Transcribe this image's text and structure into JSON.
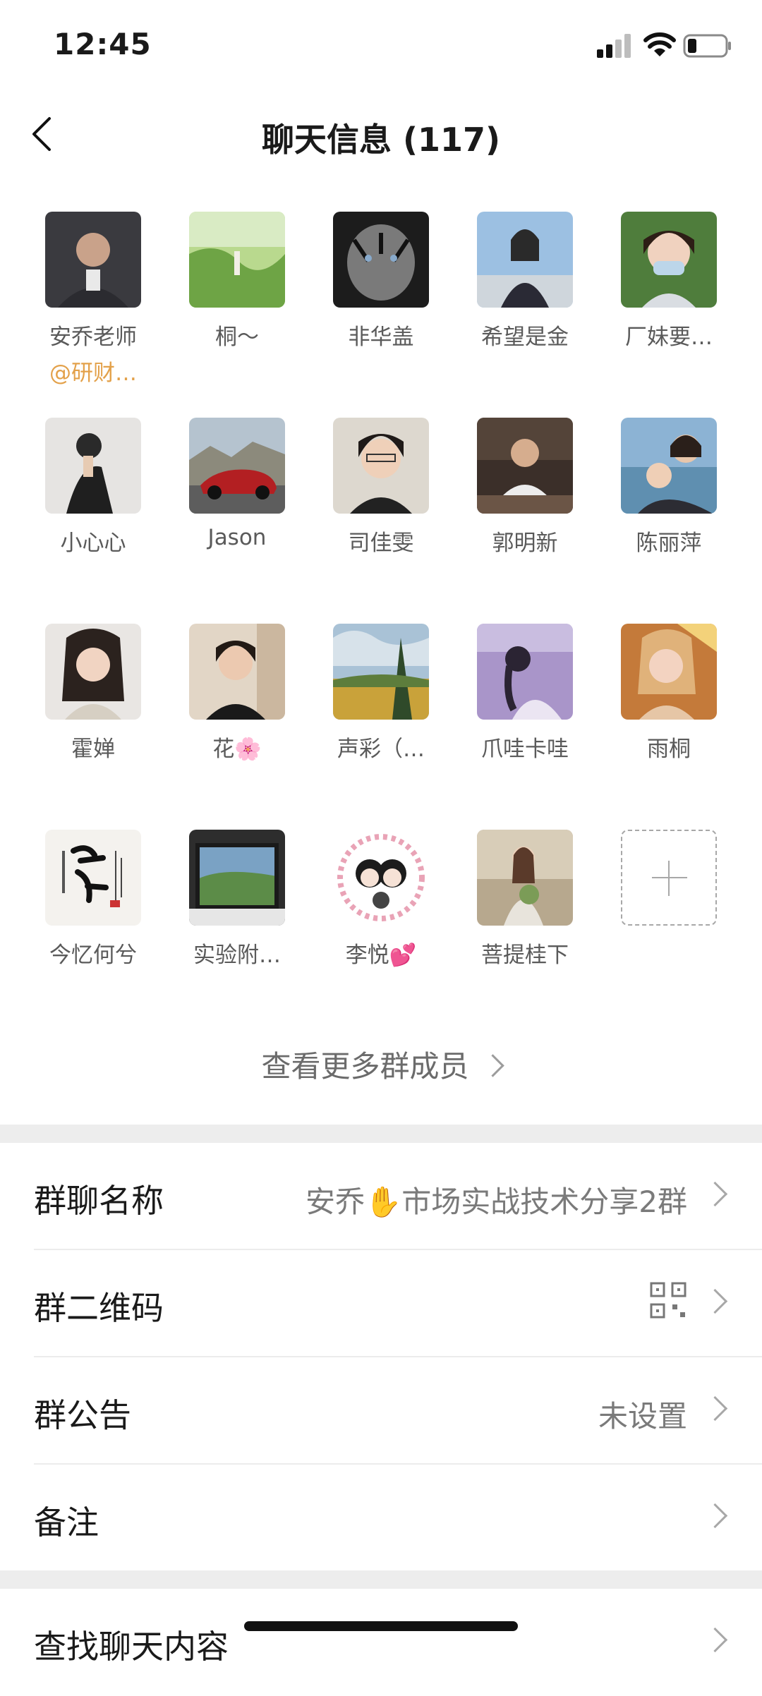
{
  "status": {
    "time": "12:45"
  },
  "nav": {
    "title": "聊天信息 (117)"
  },
  "members": [
    {
      "name": "安乔老师",
      "sub": "@研财…"
    },
    {
      "name": "桐～"
    },
    {
      "name": "非华盖"
    },
    {
      "name": "希望是金"
    },
    {
      "name": "厂妹要…"
    },
    {
      "name": "小心心"
    },
    {
      "name": "Jason"
    },
    {
      "name": "司佳雯"
    },
    {
      "name": "郭明新"
    },
    {
      "name": "陈丽萍"
    },
    {
      "name": "霍婵"
    },
    {
      "name": "花🌸"
    },
    {
      "name": "声彩（…"
    },
    {
      "name": "爪哇卡哇"
    },
    {
      "name": "雨桐"
    },
    {
      "name": "今忆何兮"
    },
    {
      "name": "实验附…"
    },
    {
      "name": "李悦💕"
    },
    {
      "name": "菩提桂下"
    }
  ],
  "more_members": "查看更多群成员",
  "settings": {
    "group_name": {
      "label": "群聊名称",
      "value": "安乔✋市场实战技术分享2群"
    },
    "group_qr": {
      "label": "群二维码"
    },
    "announcement": {
      "label": "群公告",
      "value": "未设置"
    },
    "remark": {
      "label": "备注"
    },
    "search_chat": {
      "label": "查找聊天内容"
    }
  }
}
